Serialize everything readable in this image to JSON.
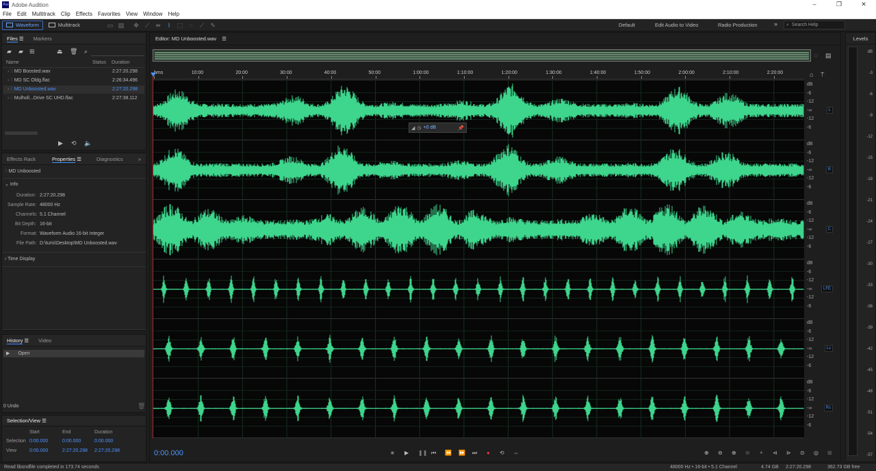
{
  "app": {
    "title": "Adobe Audition",
    "logo": "Au"
  },
  "menu": [
    "File",
    "Edit",
    "Multitrack",
    "Clip",
    "Effects",
    "Favorites",
    "View",
    "Window",
    "Help"
  ],
  "toolbar": {
    "waveform_label": "Waveform",
    "multitrack_label": "Multitrack",
    "workspaces": [
      "Default",
      "Edit Audio to Video",
      "Radio Production"
    ],
    "search_placeholder": "Search Help"
  },
  "files_panel": {
    "tabs": [
      "Files",
      "Markers"
    ],
    "columns": [
      "Name",
      "Status",
      "Duration"
    ],
    "files": [
      {
        "name": "MD Boosted.wav",
        "duration": "2:27:20.298",
        "selected": false
      },
      {
        "name": "MD SC Oldg.flac",
        "duration": "2:26:34.496",
        "selected": false
      },
      {
        "name": "MD Unboosted.wav",
        "duration": "2:27:20.298",
        "selected": true
      },
      {
        "name": "Mulholl...Drive SC UHD.flac",
        "duration": "2:27:38.112",
        "selected": false
      }
    ]
  },
  "properties_panel": {
    "tabs": [
      "Effects Rack",
      "Properties",
      "Diagnostics"
    ],
    "file_name": "MD Unboosted",
    "info_label": "Info",
    "info": [
      {
        "label": "Duration:",
        "value": "2:27:20.298"
      },
      {
        "label": "Sample Rate:",
        "value": "48000 Hz"
      },
      {
        "label": "Channels:",
        "value": "5.1 Channel"
      },
      {
        "label": "Bit Depth:",
        "value": "16-bit"
      },
      {
        "label": "Format:",
        "value": "Waveform Audio 16-bit Integer"
      },
      {
        "label": "File Path:",
        "value": "D:\\turis\\Desktop\\MD Unboosted.wav"
      }
    ],
    "time_display_label": "Time Display"
  },
  "history_panel": {
    "tabs": [
      "History",
      "Video"
    ],
    "items": [
      "Open"
    ],
    "undo_count": "0 Undo"
  },
  "selection_view": {
    "title": "Selection/View",
    "headers": [
      "Start",
      "End",
      "Duration"
    ],
    "rows": [
      {
        "label": "Selection",
        "start": "0:00.000",
        "end": "0:00.000",
        "duration": "0:00.000"
      },
      {
        "label": "View",
        "start": "0:00.000",
        "end": "2:27:20.298",
        "duration": "2:27:20.298"
      }
    ]
  },
  "editor": {
    "title": "Editor: MD Unboosted.wav",
    "ruler": [
      "hms",
      "10:00",
      "20:00",
      "30:00",
      "40:00",
      "50:00",
      "1:00:00",
      "1:10:00",
      "1:20:00",
      "1:30:00",
      "1:40:00",
      "1:50:00",
      "2:00:00",
      "2:10:00",
      "2:20:00"
    ],
    "channels": [
      "L",
      "R",
      "C",
      "LFE",
      "Ls",
      "Rs"
    ],
    "db_ticks": [
      "dB",
      "-6",
      "-12",
      "-∞",
      "-12",
      "-6"
    ],
    "hud_value": "+0 dB",
    "waveform_color": "#3ed58c",
    "timecode": "0:00.000"
  },
  "levels": {
    "title": "Levels",
    "ticks": [
      "dB",
      "-3",
      "-6",
      "-9",
      "-12",
      "-15",
      "-18",
      "-21",
      "-24",
      "-27",
      "-30",
      "-33",
      "-36",
      "-39",
      "-42",
      "-45",
      "-48",
      "-51",
      "-54",
      "-57"
    ]
  },
  "status": {
    "message": "Read libsndfile completed in 173.74 seconds",
    "format": "48000 Hz • 16-bit • 5.1 Channel",
    "size": "4.74 GB",
    "duration": "2:27:20.298",
    "free": "362.73 GB free"
  }
}
